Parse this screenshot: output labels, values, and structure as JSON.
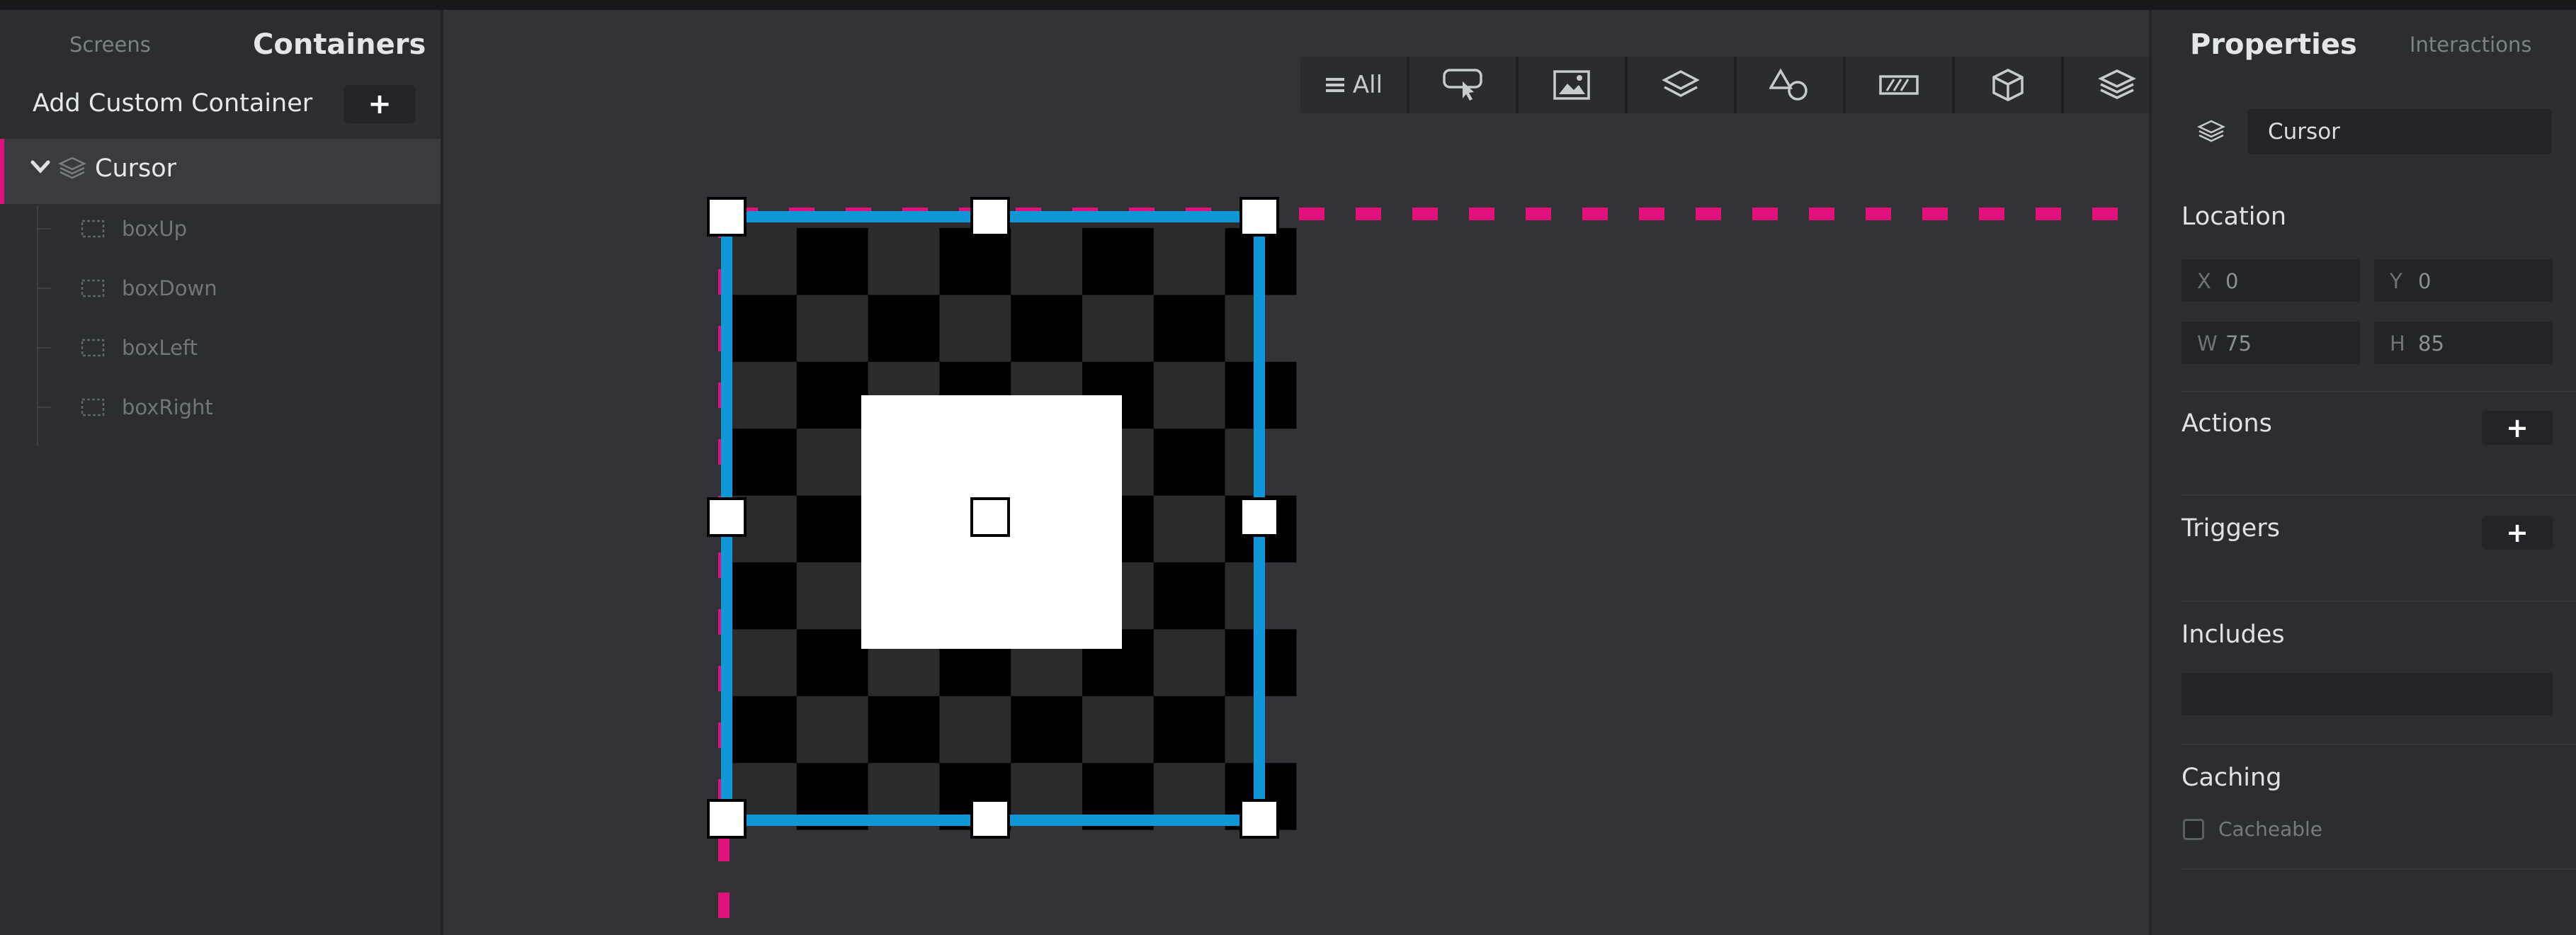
{
  "left_panel": {
    "tabs": {
      "screens": "Screens",
      "containers": "Containers"
    },
    "add_custom_label": "Add Custom Container",
    "add_button": "+",
    "tree": {
      "root": {
        "label": "Cursor",
        "icon": "layers-icon",
        "expanded": true
      },
      "children": [
        {
          "label": "boxUp",
          "icon": "box-icon"
        },
        {
          "label": "boxDown",
          "icon": "box-icon"
        },
        {
          "label": "boxLeft",
          "icon": "box-icon"
        },
        {
          "label": "boxRight",
          "icon": "box-icon"
        }
      ]
    }
  },
  "toolbar": {
    "all_label": "All",
    "filters": [
      "menu-icon",
      "touch-pointer-icon",
      "image-icon",
      "layers-icon",
      "shapes-icon",
      "scrollbar-icon",
      "cube-icon",
      "stack-icon"
    ]
  },
  "right_panel": {
    "tabs": {
      "properties": "Properties",
      "interactions": "Interactions"
    },
    "name_value": "Cursor",
    "location": {
      "title": "Location",
      "x": {
        "key": "X",
        "value": "0"
      },
      "y": {
        "key": "Y",
        "value": "0"
      },
      "w": {
        "key": "W",
        "value": "75"
      },
      "h": {
        "key": "H",
        "value": "85"
      }
    },
    "actions_title": "Actions",
    "triggers_title": "Triggers",
    "includes_title": "Includes",
    "includes_value": "",
    "caching_title": "Caching",
    "cacheable_label": "Cacheable",
    "cacheable_checked": false,
    "plus": "+"
  },
  "colors": {
    "selection": "#0f97d8",
    "guide": "#e0117b",
    "panel": "#2b2d30",
    "canvas": "#313337"
  }
}
